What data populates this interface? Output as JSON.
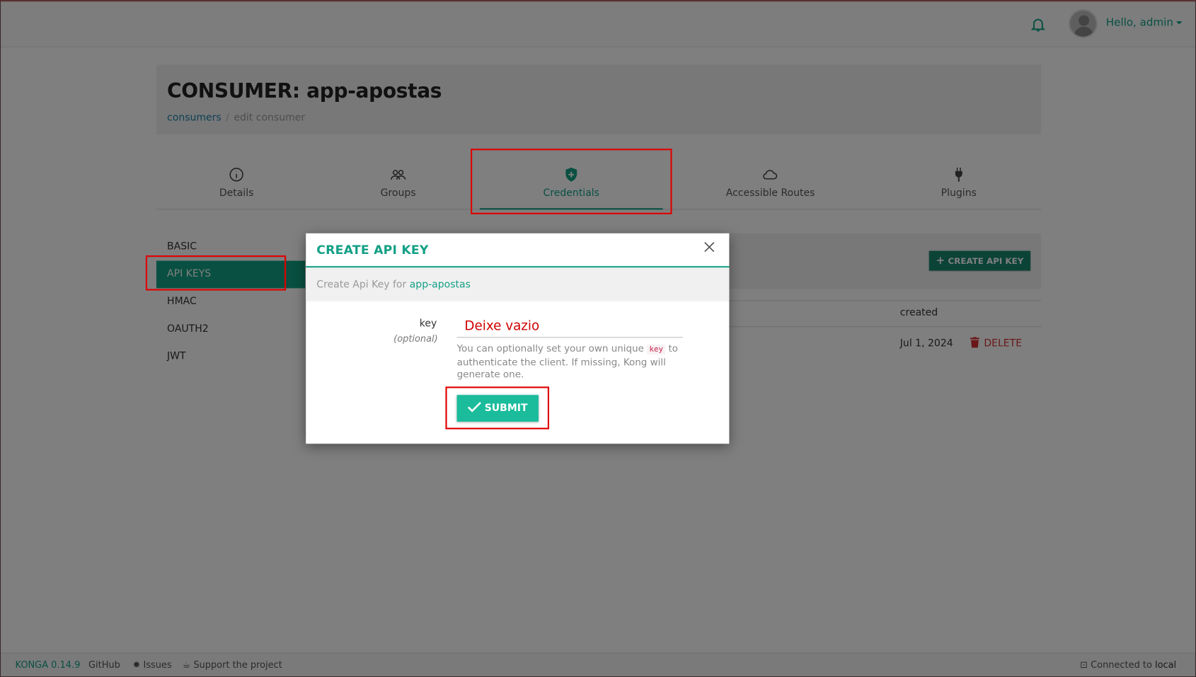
{
  "topbar": {
    "greeting": "Hello, admin"
  },
  "header": {
    "title": "CONSUMER: app-apostas",
    "breadcrumb": {
      "link": "consumers",
      "sep": "/",
      "current": "edit consumer"
    }
  },
  "tabs": [
    {
      "label": "Details",
      "icon": "info-icon"
    },
    {
      "label": "Groups",
      "icon": "users-icon"
    },
    {
      "label": "Credentials",
      "icon": "shield-icon",
      "active": true
    },
    {
      "label": "Accessible Routes",
      "icon": "cloud-icon"
    },
    {
      "label": "Plugins",
      "icon": "plug-icon"
    }
  ],
  "sidebar": {
    "items": [
      {
        "label": "BASIC"
      },
      {
        "label": "API KEYS",
        "active": true
      },
      {
        "label": "HMAC"
      },
      {
        "label": "OAUTH2"
      },
      {
        "label": "JWT"
      }
    ]
  },
  "panel": {
    "create_button": "CREATE API KEY",
    "columns": {
      "created": "created"
    },
    "rows": [
      {
        "created": "Jul 1, 2024",
        "action": "DELETE"
      }
    ]
  },
  "modal": {
    "title": "CREATE API KEY",
    "subtitle_prefix": "Create Api Key for",
    "subtitle_name": "app-apostas",
    "key_label": "key",
    "key_optional": "(optional)",
    "key_placeholder": "Deixe vazio",
    "help_before": "You can optionally set your own unique",
    "help_code": "key",
    "help_after": "to authenticate the client. If missing, Kong will generate one.",
    "submit": "SUBMIT"
  },
  "footer": {
    "version": "KONGA 0.14.9",
    "github": "GitHub",
    "issues": "Issues",
    "support": "Support the project",
    "connected_prefix": "Connected to",
    "connected_target": "local"
  },
  "colors": {
    "accent": "#13a085",
    "highlight": "#e00000",
    "danger": "#d32f2f"
  }
}
